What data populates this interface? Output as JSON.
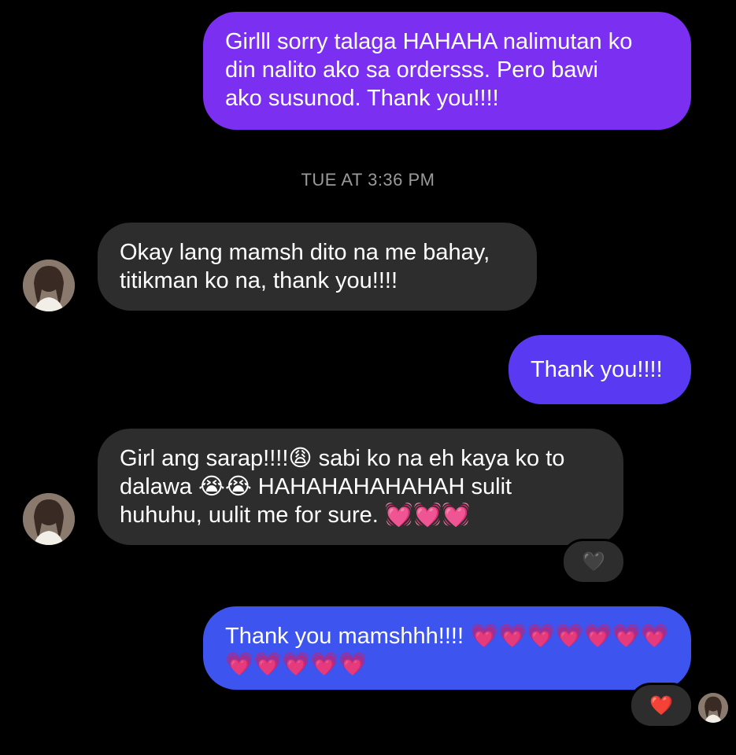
{
  "colors": {
    "background": "#000000",
    "incoming_bubble": "#2d2d2d",
    "outgoing_purple": "#7b2ff0",
    "outgoing_indigo": "#5a39f2",
    "outgoing_blue": "#3d55ee",
    "timestamp": "#9a9a9a"
  },
  "messages": [
    {
      "direction": "outgoing",
      "text": "Girlll sorry talaga HAHAHA nalimutan ko\ndin nalito ako sa ordersss. Pero bawi\nako susunod. Thank you!!!!"
    },
    {
      "direction": "incoming",
      "text": "Okay lang mamsh dito na me bahay,\ntitikman ko na, thank you!!!!"
    },
    {
      "direction": "outgoing",
      "text": "Thank you!!!!"
    },
    {
      "direction": "incoming",
      "text": "Girl ang sarap!!!!😩 sabi ko na eh kaya ko to\ndalawa 😭😭 HAHAHAHAHAHAH sulit\nhuhuhu, uulit me for sure. 💓💓💓",
      "reaction": "🖤"
    },
    {
      "direction": "outgoing",
      "text": "Thank you mamshhh!!!! 💗💗💗💗💗💗💗\n💗💗💗💗💗",
      "reaction": "❤️"
    }
  ],
  "timestamp": "TUE AT 3:36 PM",
  "icons": {
    "avatar": "contact-avatar",
    "reaction_black_heart": "black-heart-icon",
    "reaction_red_heart": "red-heart-icon"
  }
}
